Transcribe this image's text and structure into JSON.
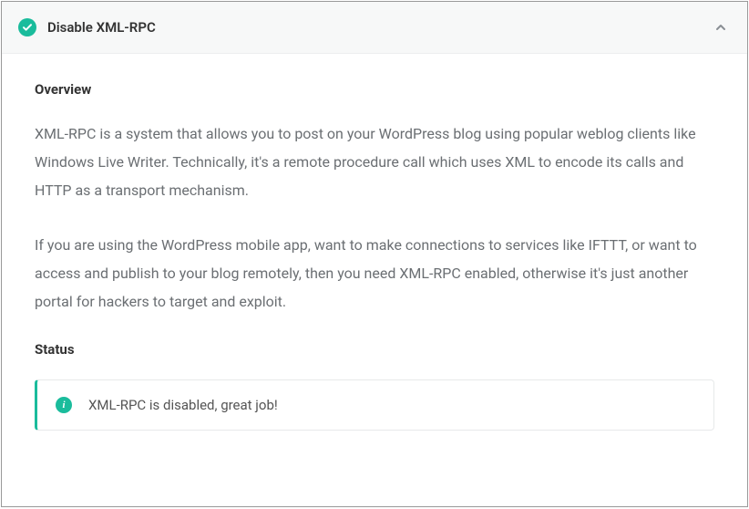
{
  "colors": {
    "accent": "#1abc9c"
  },
  "header": {
    "icon": "check-circle",
    "title": "Disable XML-RPC",
    "collapse_icon": "chevron-up"
  },
  "overview": {
    "heading": "Overview",
    "p1": "XML-RPC is a system that allows you to post on your WordPress blog using popular weblog clients like Windows Live Writer. Technically, it's a remote procedure call which uses XML to encode its calls and HTTP as a transport mechanism.",
    "p2": "If you are using the WordPress mobile app, want to make connections to services like IFTTT, or want to access and publish to your blog remotely, then you need XML-RPC enabled, otherwise it's just another portal for hackers to target and exploit."
  },
  "status": {
    "heading": "Status",
    "icon": "info-circle",
    "message": "XML-RPC is disabled, great job!"
  }
}
